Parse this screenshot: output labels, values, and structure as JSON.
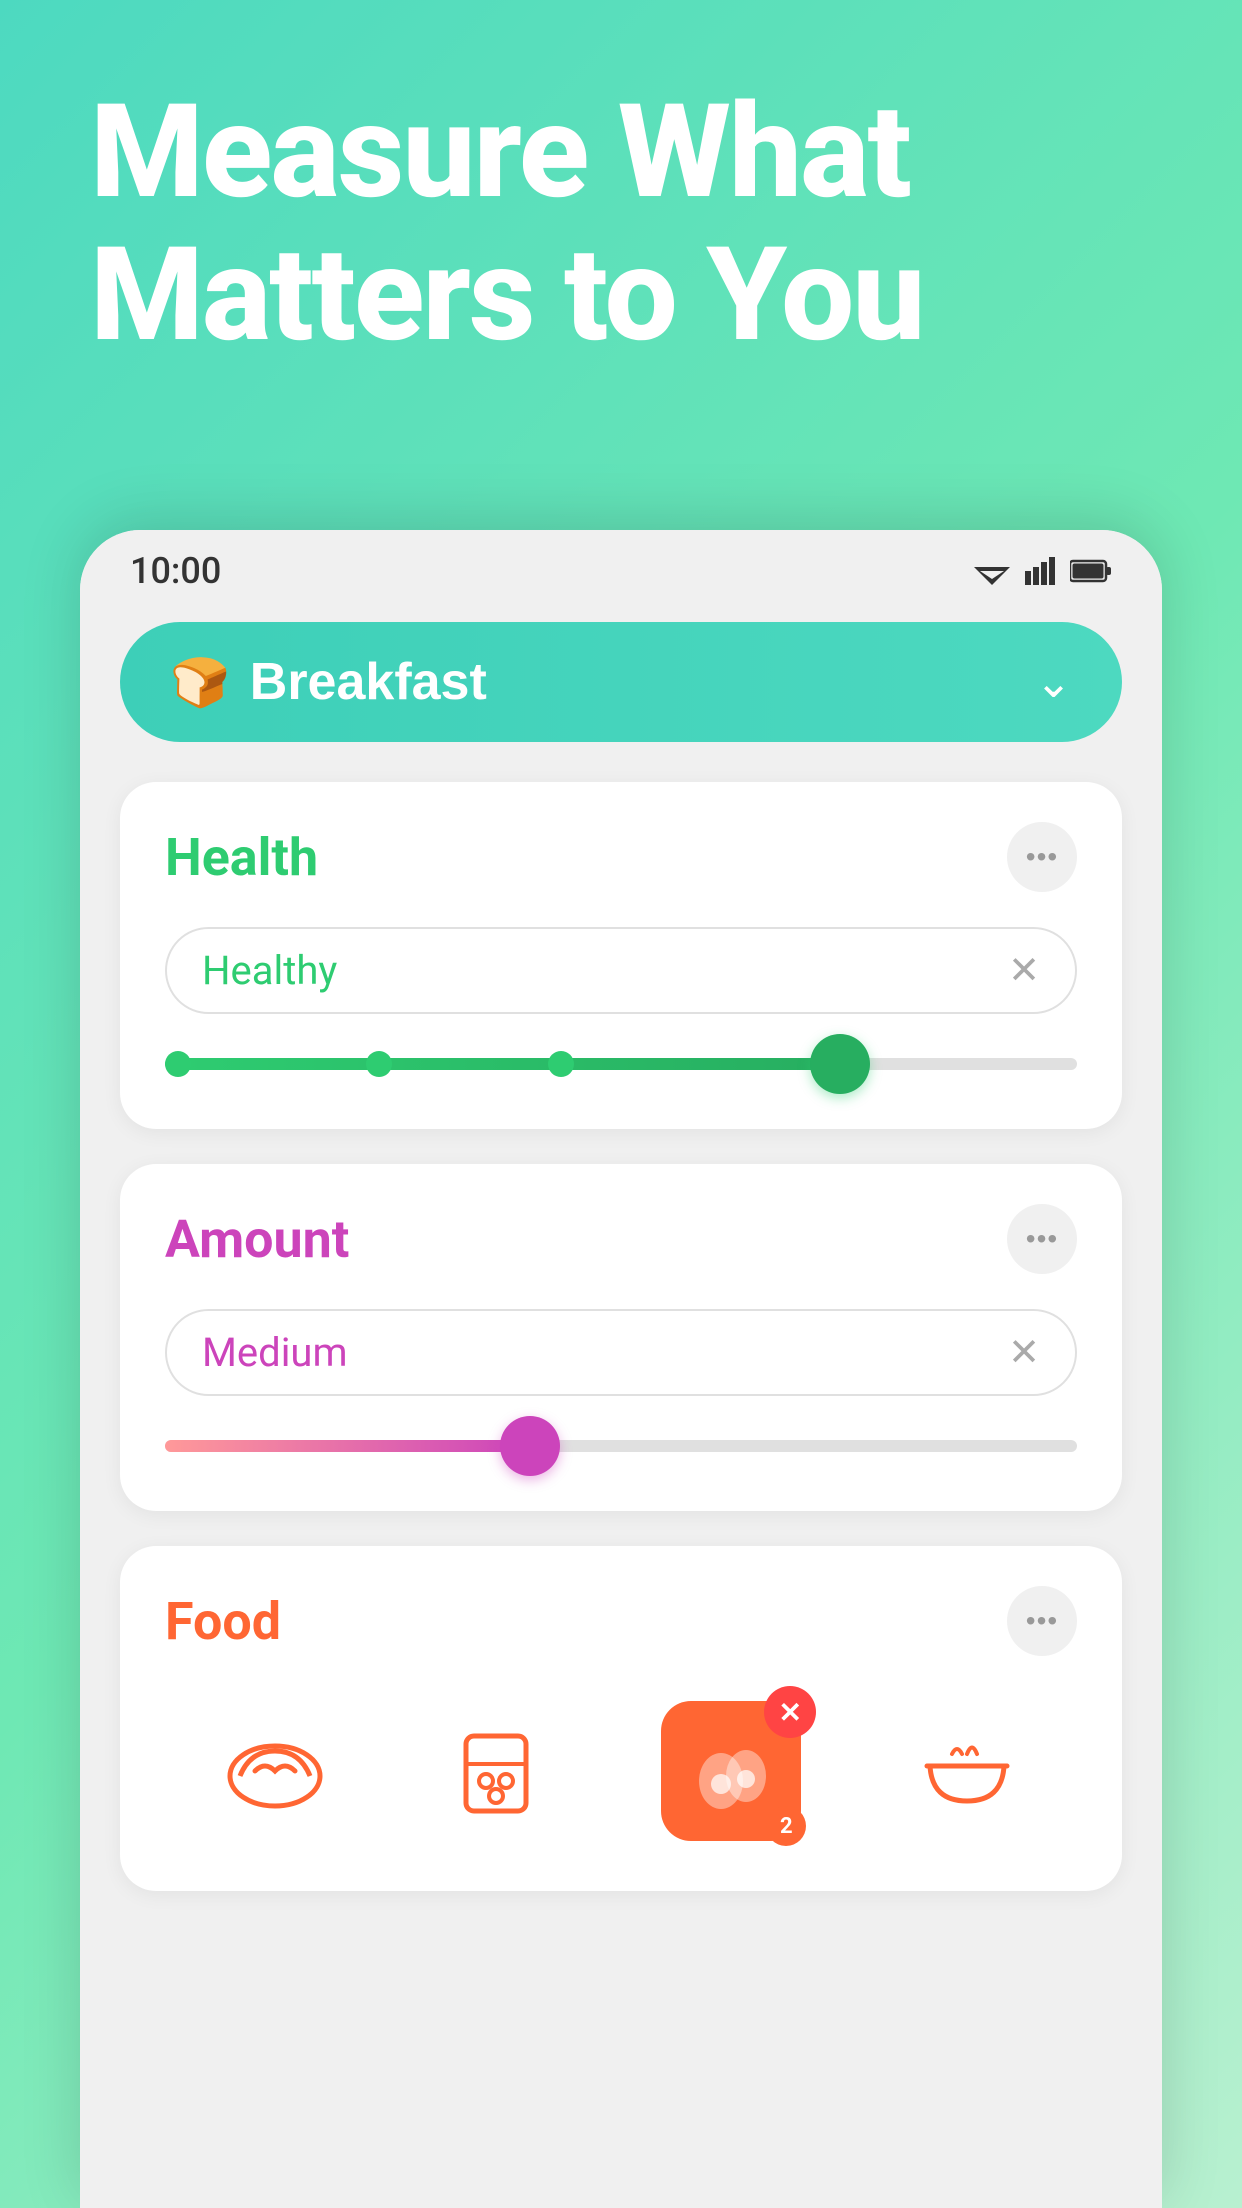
{
  "hero": {
    "title_line1": "Measure What",
    "title_line2": "Matters to You"
  },
  "status_bar": {
    "time": "10:00"
  },
  "breakfast_btn": {
    "label": "Breakfast",
    "icon": "🍞"
  },
  "health_card": {
    "title": "Health",
    "tag": "Healthy",
    "slider_fill_pct": 74,
    "more_label": "•••"
  },
  "amount_card": {
    "title": "Amount",
    "tag": "Medium",
    "slider_fill_pct": 40,
    "more_label": "•••"
  },
  "food_card": {
    "title": "Food",
    "more_label": "•••",
    "items": [
      {
        "name": "bread",
        "icon": "bread"
      },
      {
        "name": "cereal",
        "icon": "cereal"
      },
      {
        "name": "eggs",
        "icon": "eggs",
        "selected": true,
        "count": 2
      },
      {
        "name": "bowl",
        "icon": "bowl"
      }
    ]
  }
}
